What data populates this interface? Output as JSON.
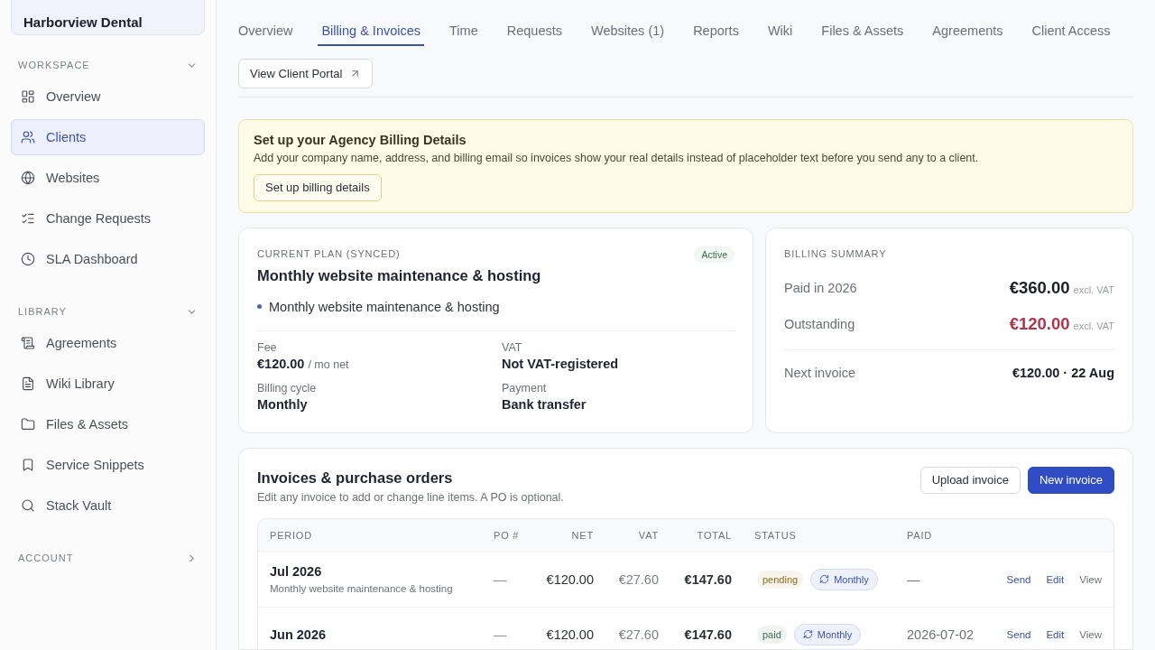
{
  "sidebar": {
    "client": "Harborview Dental",
    "sections": [
      {
        "title": "WORKSPACE",
        "expanded": true,
        "items": [
          {
            "label": "Overview",
            "selected": false
          },
          {
            "label": "Clients",
            "selected": true
          },
          {
            "label": "Websites",
            "selected": false
          },
          {
            "label": "Change Requests",
            "selected": false
          },
          {
            "label": "SLA Dashboard",
            "selected": false
          }
        ]
      },
      {
        "title": "LIBRARY",
        "expanded": true,
        "items": [
          {
            "label": "Agreements",
            "selected": false
          },
          {
            "label": "Wiki Library",
            "selected": false
          },
          {
            "label": "Files & Assets",
            "selected": false
          },
          {
            "label": "Service Snippets",
            "selected": false
          },
          {
            "label": "Stack Vault",
            "selected": false
          }
        ]
      },
      {
        "title": "ACCOUNT",
        "expanded": false
      }
    ]
  },
  "tabs": [
    {
      "label": "Overview",
      "selected": false
    },
    {
      "label": "Billing & Invoices",
      "selected": true
    },
    {
      "label": "Time",
      "selected": false
    },
    {
      "label": "Requests",
      "selected": false
    },
    {
      "label": "Websites (1)",
      "selected": false
    },
    {
      "label": "Reports",
      "selected": false
    },
    {
      "label": "Wiki",
      "selected": false
    },
    {
      "label": "Files & Assets",
      "selected": false
    },
    {
      "label": "Agreements",
      "selected": false
    },
    {
      "label": "Client Access",
      "selected": false
    }
  ],
  "portal_button": "View Client Portal",
  "banner": {
    "title": "Set up your Agency Billing Details",
    "text": "Add your company name, address, and billing email so invoices show your real details instead of placeholder text before you send any to a client.",
    "button": "Set up billing details"
  },
  "plan": {
    "label": "CURRENT PLAN (SYNCED)",
    "badge": "Active",
    "title": "Monthly website maintenance & hosting",
    "bullet": "Monthly website maintenance & hosting",
    "fields": [
      {
        "label": "Fee",
        "value": "€120.00",
        "suffix": "/ mo net"
      },
      {
        "label": "VAT",
        "value": "Not VAT-registered"
      },
      {
        "label": "Billing cycle",
        "value": "Monthly"
      },
      {
        "label": "Payment",
        "value": "Bank transfer"
      }
    ]
  },
  "summary": {
    "label": "BILLING SUMMARY",
    "rows": [
      {
        "kind": "paid",
        "label": "Paid in 2026",
        "amount": "€360.00",
        "note": "excl. VAT"
      },
      {
        "kind": "outstanding",
        "label": "Outstanding",
        "amount": "€120.00",
        "note": "excl. VAT"
      },
      {
        "kind": "plain",
        "label": "Next invoice",
        "amount": "€120.00 · 22 Aug"
      }
    ]
  },
  "invoices": {
    "title": "Invoices & purchase orders",
    "subtitle": "Edit any invoice to add or change line items. A PO is optional.",
    "buttons": [
      {
        "label": "Upload invoice",
        "kind": "secondary"
      },
      {
        "label": "New invoice",
        "kind": "primary"
      }
    ],
    "columns": [
      "PERIOD",
      "PO #",
      "NET",
      "VAT",
      "TOTAL",
      "STATUS",
      "PAID"
    ],
    "rows": [
      {
        "period": "Jul 2026",
        "description": "Monthly website maintenance & hosting",
        "po": "—",
        "net": "€120.00",
        "vat": "€27.60",
        "total": "€147.60",
        "status": {
          "label": "pending",
          "color": "#8a6d1f"
        },
        "recurrence": "Monthly",
        "paid": "—",
        "actions": [
          "Send",
          "Edit",
          "View"
        ]
      },
      {
        "period": "Jun 2026",
        "po": "—",
        "net": "€120.00",
        "vat": "€27.60",
        "total": "€147.60",
        "status": {
          "label": "paid",
          "color": "#3c6b4f"
        },
        "recurrence": "Monthly",
        "paid": "2026-07-02",
        "actions": [
          "Send",
          "Edit",
          "View"
        ]
      }
    ]
  }
}
